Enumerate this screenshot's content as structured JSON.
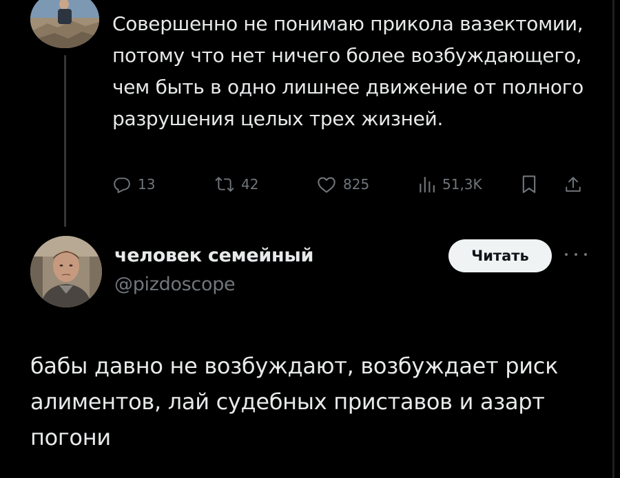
{
  "parent_tweet": {
    "text": "Совершенно не понимаю прикола вазектомии, потому что нет ничего более возбуждающего, чем быть в одно лишнее движение от полного разрушения целых трех жизней.",
    "actions": {
      "reply": {
        "icon": "reply-icon",
        "count": "13"
      },
      "retweet": {
        "icon": "retweet-icon",
        "count": "42"
      },
      "like": {
        "icon": "heart-icon",
        "count": "825"
      },
      "views": {
        "icon": "views-icon",
        "count": "51,3K"
      },
      "bookmark": {
        "icon": "bookmark-icon"
      },
      "share": {
        "icon": "share-icon"
      }
    }
  },
  "reply_tweet": {
    "author_name": "человек семейный",
    "author_handle": "@pizdoscope",
    "follow_label": "Читать",
    "more_icon": "more-icon",
    "text": "бабы давно не возбуждают, возбуждает риск алиментов, лай судебных приставов и азарт погони"
  },
  "colors": {
    "background": "#000000",
    "text": "#e7e9ea",
    "secondary_text": "#71767b",
    "button_bg": "#eff3f4",
    "thread_line": "#333639"
  }
}
